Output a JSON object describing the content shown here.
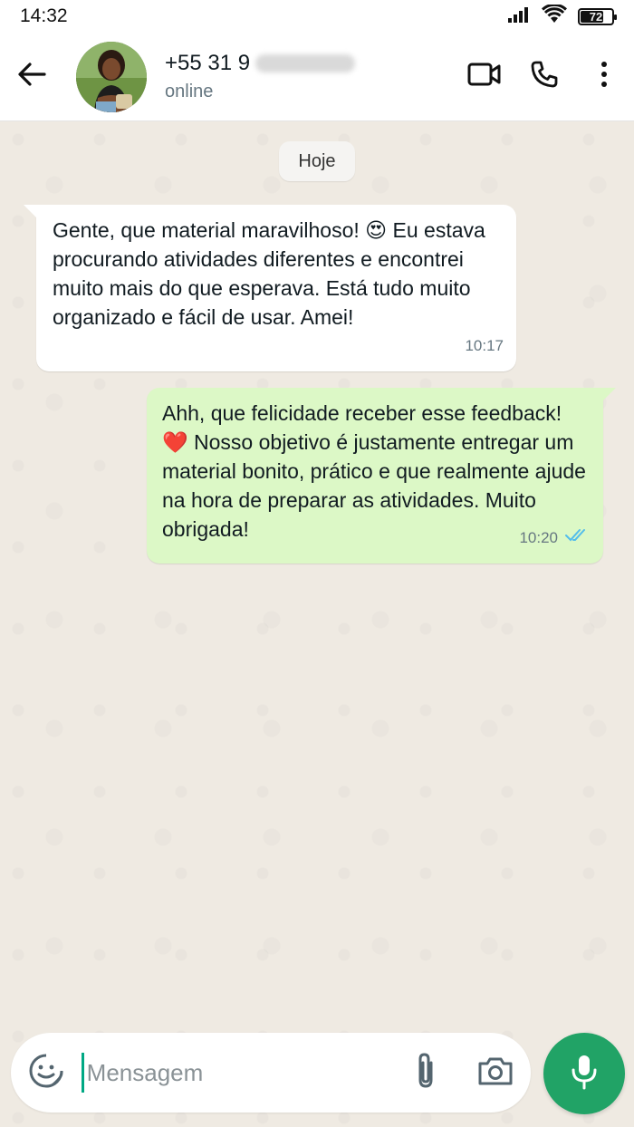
{
  "status_bar": {
    "time": "14:32",
    "battery": "72"
  },
  "header": {
    "contact_name": "+55 31 9",
    "contact_status": "online"
  },
  "chat": {
    "date_divider": "Hoje",
    "messages": [
      {
        "direction": "incoming",
        "text": "Gente, que material maravilhoso! 😍 Eu estava procurando atividades diferentes e encontrei muito mais do que esperava. Está tudo muito organizado e fácil de usar. Amei!",
        "time": "10:17"
      },
      {
        "direction": "outgoing",
        "text": "Ahh, que felicidade receber esse feedback! ❤️ Nosso objetivo é justamente entregar um material bonito, prático e que realmente ajude na hora de preparar as atividades. Muito obrigada!",
        "time": "10:20",
        "read_status": "read"
      }
    ]
  },
  "composer": {
    "placeholder": "Mensagem"
  },
  "colors": {
    "accent": "#21a366",
    "outgoing_bubble": "#dcf8c6",
    "read_ticks": "#53bdeb"
  },
  "icons": [
    "back-arrow-icon",
    "video-call-icon",
    "phone-icon",
    "more-options-icon",
    "sticker-icon",
    "attach-icon",
    "camera-icon",
    "mic-icon"
  ]
}
